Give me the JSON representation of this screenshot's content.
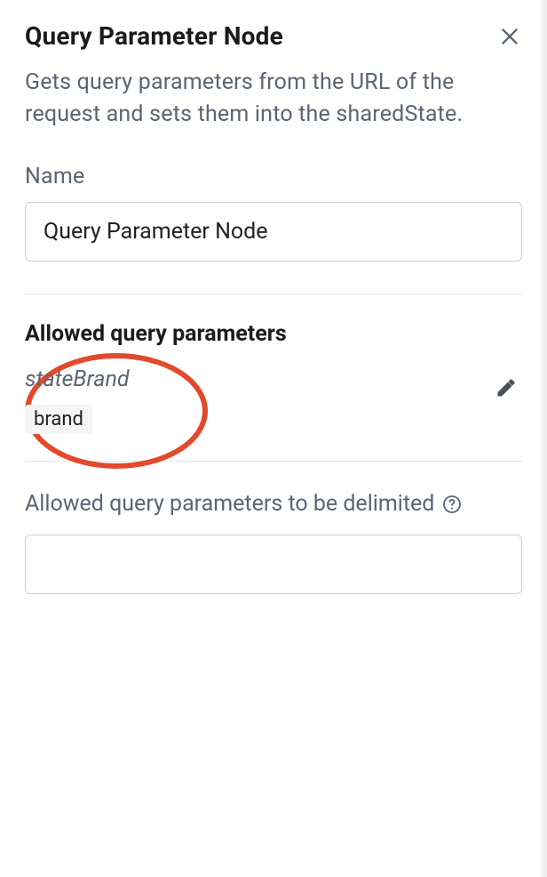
{
  "header": {
    "title": "Query Parameter Node"
  },
  "description": "Gets query parameters from the URL of the request and sets them into the sharedState.",
  "nameField": {
    "label": "Name",
    "value": "Query Parameter Node"
  },
  "allowedSection": {
    "title": "Allowed query parameters",
    "items": [
      {
        "key": "stateBrand",
        "value": "brand"
      }
    ]
  },
  "delimitedSection": {
    "label": "Allowed query parameters to be delimited",
    "value": ""
  }
}
